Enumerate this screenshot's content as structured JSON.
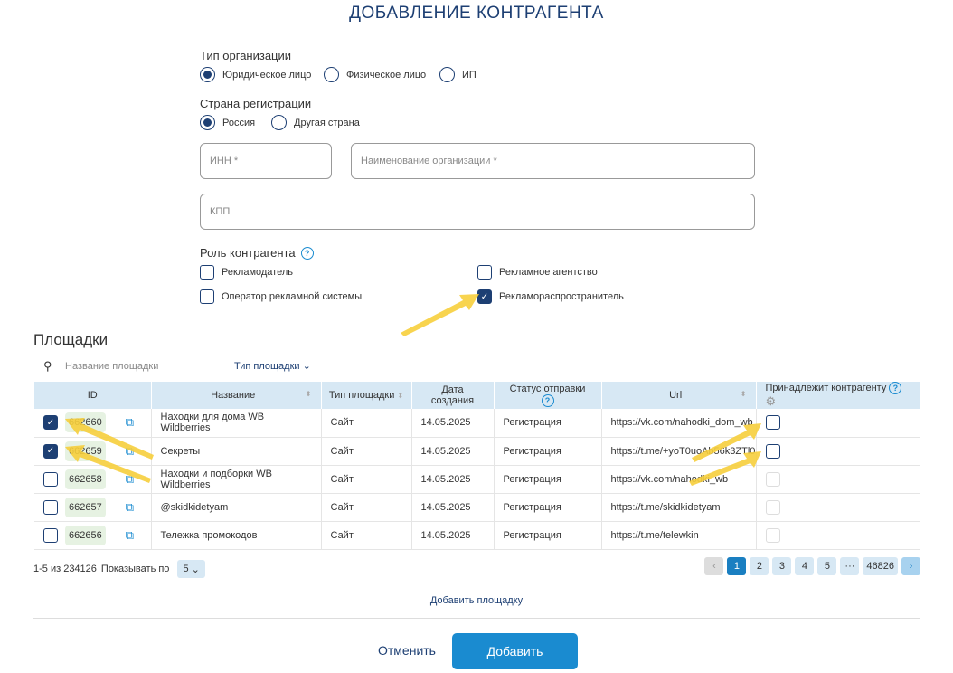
{
  "title": "ДОБАВЛЕНИЕ КОНТРАГЕНТА",
  "org_type": {
    "label": "Тип организации",
    "options": [
      "Юридическое лицо",
      "Физическое лицо",
      "ИП"
    ],
    "selected": 0
  },
  "country": {
    "label": "Страна регистрации",
    "options": [
      "Россия",
      "Другая страна"
    ],
    "selected": 0
  },
  "fields": {
    "inn": "ИНН *",
    "name": "Наименование организации *",
    "kpp": "КПП"
  },
  "role": {
    "label": "Роль контрагента",
    "help": "?",
    "options": [
      {
        "label": "Рекламодатель",
        "checked": false
      },
      {
        "label": "Рекламное агентство",
        "checked": false
      },
      {
        "label": "Оператор рекламной системы",
        "checked": false
      },
      {
        "label": "Рекламораспространитель",
        "checked": true
      }
    ]
  },
  "sites": {
    "title": "Площадки",
    "search_placeholder": "Название площадки",
    "type_filter": "Тип площадки",
    "columns": [
      "ID",
      "Название",
      "Тип площадки",
      "Дата создания",
      "Статус отправки",
      "Url",
      "Принадлежит контрагенту"
    ],
    "rows": [
      {
        "checked": true,
        "id": "662660",
        "name": "Находки для дома WB Wildberries",
        "type": "Сайт",
        "date": "14.05.2025",
        "status": "Регистрация",
        "url": "https://vk.com/nahodki_dom_wb",
        "belongs": "enabled"
      },
      {
        "checked": true,
        "id": "662659",
        "name": "Секреты",
        "type": "Сайт",
        "date": "14.05.2025",
        "status": "Регистрация",
        "url": "https://t.me/+yoT0uoAb56k3ZTl0",
        "belongs": "enabled"
      },
      {
        "checked": false,
        "id": "662658",
        "name": "Находки и подборки WB Wildberries",
        "type": "Сайт",
        "date": "14.05.2025",
        "status": "Регистрация",
        "url": "https://vk.com/nahodki_wb",
        "belongs": "disabled"
      },
      {
        "checked": false,
        "id": "662657",
        "name": "@skidkidetyam",
        "type": "Сайт",
        "date": "14.05.2025",
        "status": "Регистрация",
        "url": "https://t.me/skidkidetyam",
        "belongs": "disabled"
      },
      {
        "checked": false,
        "id": "662656",
        "name": "Тележка промокодов",
        "type": "Сайт",
        "date": "14.05.2025",
        "status": "Регистрация",
        "url": "https://t.me/telewkin",
        "belongs": "disabled"
      }
    ],
    "range": "1-5 из 234126",
    "per_page_label": "Показывать по",
    "per_page": "5",
    "pages": [
      "1",
      "2",
      "3",
      "4",
      "5",
      "···",
      "46826"
    ],
    "current_page": "1",
    "add_site": "Добавить площадку"
  },
  "buttons": {
    "cancel": "Отменить",
    "add": "Добавить"
  },
  "colors": {
    "primary": "#1d3f73",
    "accent": "#1a8bd0",
    "header_bg": "#d7e8f4",
    "arrow": "#f7cf3c"
  }
}
